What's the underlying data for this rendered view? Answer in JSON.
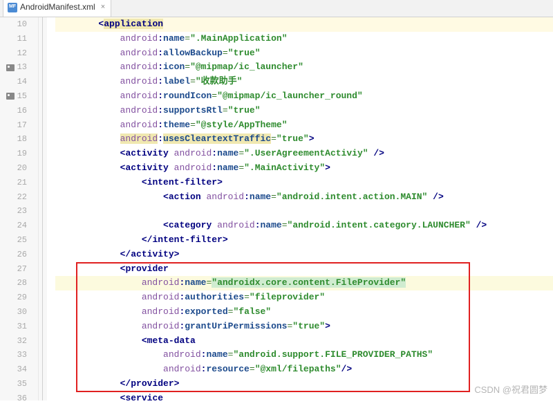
{
  "tab": {
    "filename": "AndroidManifest.xml",
    "icon_label": "MF"
  },
  "gutter": {
    "lines": [
      10,
      11,
      12,
      13,
      14,
      15,
      16,
      17,
      18,
      19,
      20,
      21,
      22,
      23,
      24,
      25,
      26,
      27,
      28,
      29,
      30,
      31,
      32,
      33,
      34,
      35,
      36
    ],
    "icon_lines": [
      13,
      15
    ]
  },
  "code": {
    "lines": [
      {
        "n": 10,
        "indent": 8,
        "kind": "open-tag-start",
        "tag": "application",
        "hl": "keyword"
      },
      {
        "n": 11,
        "indent": 12,
        "kind": "attr",
        "ns": "android",
        "attr": "name",
        "val": ".MainApplication"
      },
      {
        "n": 12,
        "indent": 12,
        "kind": "attr",
        "ns": "android",
        "attr": "allowBackup",
        "val": "true"
      },
      {
        "n": 13,
        "indent": 12,
        "kind": "attr",
        "ns": "android",
        "attr": "icon",
        "val": "@mipmap/ic_launcher"
      },
      {
        "n": 14,
        "indent": 12,
        "kind": "attr",
        "ns": "android",
        "attr": "label",
        "val": "收款助手"
      },
      {
        "n": 15,
        "indent": 12,
        "kind": "attr",
        "ns": "android",
        "attr": "roundIcon",
        "val": "@mipmap/ic_launcher_round"
      },
      {
        "n": 16,
        "indent": 12,
        "kind": "attr",
        "ns": "android",
        "attr": "supportsRtl",
        "val": "true"
      },
      {
        "n": 17,
        "indent": 12,
        "kind": "attr",
        "ns": "android",
        "attr": "theme",
        "val": "@style/AppTheme"
      },
      {
        "n": 18,
        "indent": 12,
        "kind": "attr-close",
        "ns": "android",
        "attr": "usesCleartextTraffic",
        "val": "true",
        "hl": "keyword"
      },
      {
        "n": 19,
        "indent": 12,
        "kind": "inline-self",
        "tag": "activity",
        "ns": "android",
        "attr": "name",
        "val": ".UserAgreementActiviy"
      },
      {
        "n": 20,
        "indent": 12,
        "kind": "inline-open",
        "tag": "activity",
        "ns": "android",
        "attr": "name",
        "val": ".MainActivity"
      },
      {
        "n": 21,
        "indent": 16,
        "kind": "open-tag",
        "tag": "intent-filter"
      },
      {
        "n": 22,
        "indent": 20,
        "kind": "inline-self",
        "tag": "action",
        "ns": "android",
        "attr": "name",
        "val": "android.intent.action.MAIN"
      },
      {
        "n": 23,
        "indent": 20,
        "kind": "blank"
      },
      {
        "n": 24,
        "indent": 20,
        "kind": "inline-self",
        "tag": "category",
        "ns": "android",
        "attr": "name",
        "val": "android.intent.category.LAUNCHER"
      },
      {
        "n": 25,
        "indent": 16,
        "kind": "close-tag",
        "tag": "intent-filter"
      },
      {
        "n": 26,
        "indent": 12,
        "kind": "close-tag",
        "tag": "activity"
      },
      {
        "n": 27,
        "indent": 12,
        "kind": "open-tag-start",
        "tag": "provider"
      },
      {
        "n": 28,
        "indent": 16,
        "kind": "attr",
        "ns": "android",
        "attr": "name",
        "val": "androidx.core.content.FileProvider",
        "hl": "str",
        "current": true
      },
      {
        "n": 29,
        "indent": 16,
        "kind": "attr",
        "ns": "android",
        "attr": "authorities",
        "val": "fileprovider"
      },
      {
        "n": 30,
        "indent": 16,
        "kind": "attr",
        "ns": "android",
        "attr": "exported",
        "val": "false"
      },
      {
        "n": 31,
        "indent": 16,
        "kind": "attr-close",
        "ns": "android",
        "attr": "grantUriPermissions",
        "val": "true"
      },
      {
        "n": 32,
        "indent": 16,
        "kind": "open-tag-start",
        "tag": "meta-data"
      },
      {
        "n": 33,
        "indent": 20,
        "kind": "attr",
        "ns": "android",
        "attr": "name",
        "val": "android.support.FILE_PROVIDER_PATHS"
      },
      {
        "n": 34,
        "indent": 20,
        "kind": "attr-self-close",
        "ns": "android",
        "attr": "resource",
        "val": "@xml/filepaths"
      },
      {
        "n": 35,
        "indent": 12,
        "kind": "close-tag",
        "tag": "provider"
      },
      {
        "n": 36,
        "indent": 12,
        "kind": "open-tag-start",
        "tag": "service"
      }
    ]
  },
  "watermark": "CSDN @祝君圆梦"
}
